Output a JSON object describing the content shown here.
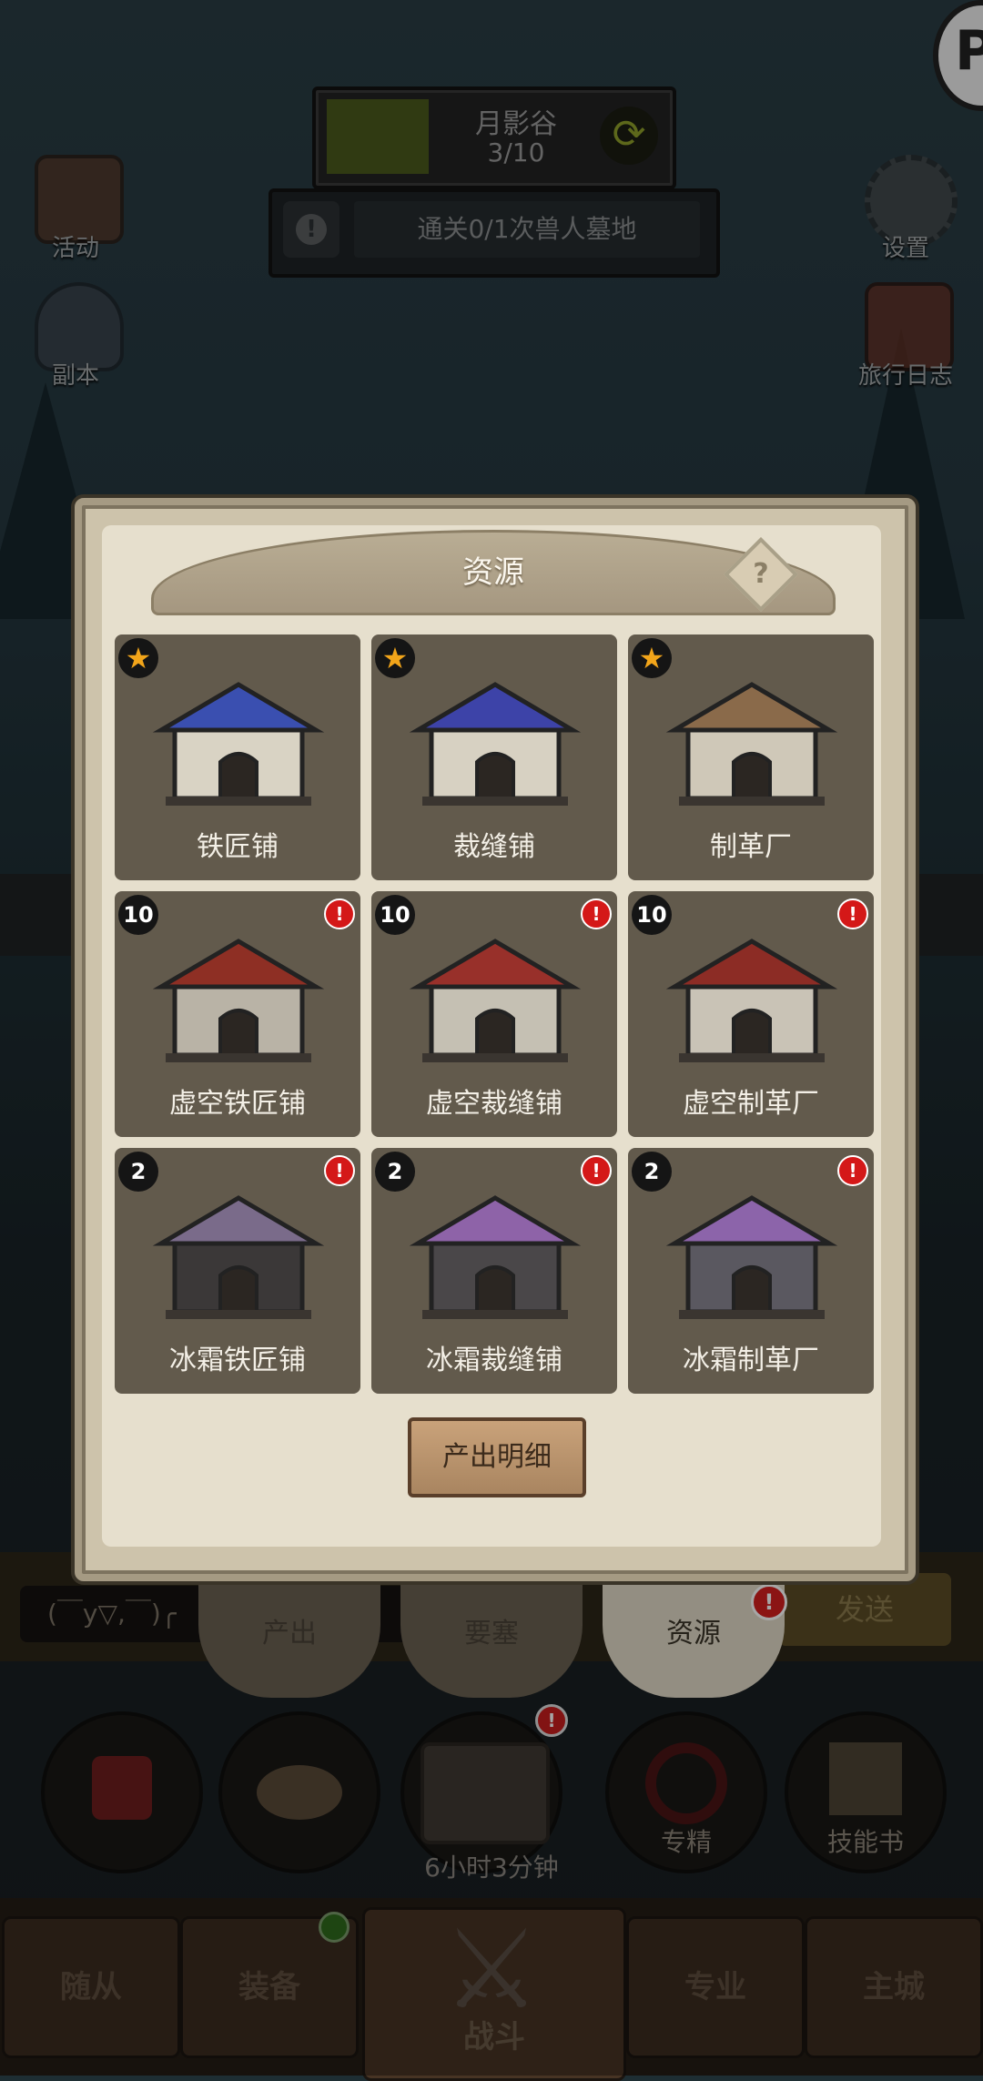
{
  "stage": {
    "name": "月影谷",
    "progress": "3/10"
  },
  "quest": {
    "text": "通关0/1次兽人墓地"
  },
  "side_left": [
    {
      "label": "活动",
      "icon": "book-icon"
    },
    {
      "label": "副本",
      "icon": "portal-icon"
    }
  ],
  "side_right": [
    {
      "label": "设置",
      "icon": "gear-icon"
    },
    {
      "label": "旅行日志",
      "icon": "journal-icon"
    }
  ],
  "modal": {
    "title": "资源",
    "help": "?",
    "cards": [
      {
        "name": "铁匠铺",
        "badge": "★",
        "badge_type": "star",
        "alert": false,
        "roof": "#3a4fb0",
        "wall": "#d9d3c4"
      },
      {
        "name": "裁缝铺",
        "badge": "★",
        "badge_type": "star",
        "alert": false,
        "roof": "#3d43a8",
        "wall": "#d7d1c2"
      },
      {
        "name": "制革厂",
        "badge": "★",
        "badge_type": "star",
        "alert": false,
        "roof": "#8a6a4a",
        "wall": "#cfc8b8"
      },
      {
        "name": "虚空铁匠铺",
        "badge": "10",
        "badge_type": "level",
        "alert": true,
        "roof": "#8e2f24",
        "wall": "#b9b3a6"
      },
      {
        "name": "虚空裁缝铺",
        "badge": "10",
        "badge_type": "level",
        "alert": true,
        "roof": "#98302a",
        "wall": "#c5c0b3"
      },
      {
        "name": "虚空制革厂",
        "badge": "10",
        "badge_type": "level",
        "alert": true,
        "roof": "#8c2c25",
        "wall": "#c9c3b6"
      },
      {
        "name": "冰霜铁匠铺",
        "badge": "2",
        "badge_type": "level",
        "alert": true,
        "roof": "#7a6b8a",
        "wall": "#3b3838"
      },
      {
        "name": "冰霜裁缝铺",
        "badge": "2",
        "badge_type": "level",
        "alert": true,
        "roof": "#8e63a8",
        "wall": "#4a4749"
      },
      {
        "name": "冰霜制革厂",
        "badge": "2",
        "badge_type": "level",
        "alert": true,
        "roof": "#8c64aa",
        "wall": "#5a5860"
      }
    ],
    "alert_glyph": "!",
    "detail_button": "产出明细"
  },
  "chat": {
    "input_text": "(￣y▽,￣)╭",
    "send": "发送"
  },
  "tabs": [
    {
      "label": "产出"
    },
    {
      "label": "要塞"
    },
    {
      "label": "资源",
      "badge": "!"
    }
  ],
  "slots": [
    {
      "label": "",
      "icon": "potion-icon"
    },
    {
      "label": "",
      "icon": "bread-icon"
    },
    {
      "label": "",
      "icon": "chest-icon"
    },
    {
      "label": "专精",
      "icon": "specialization-icon"
    },
    {
      "label": "技能书",
      "icon": "skillbook-icon"
    }
  ],
  "chest_timer": "6小时3分钟",
  "nav": {
    "followers": "随从",
    "equipment": "装备",
    "battle": "战斗",
    "profession": "专业",
    "city": "主城"
  },
  "colors": {
    "accent": "#d41818",
    "star": "#f2a51a",
    "parchment": "#e6dfcd",
    "card": "#625a4c"
  }
}
